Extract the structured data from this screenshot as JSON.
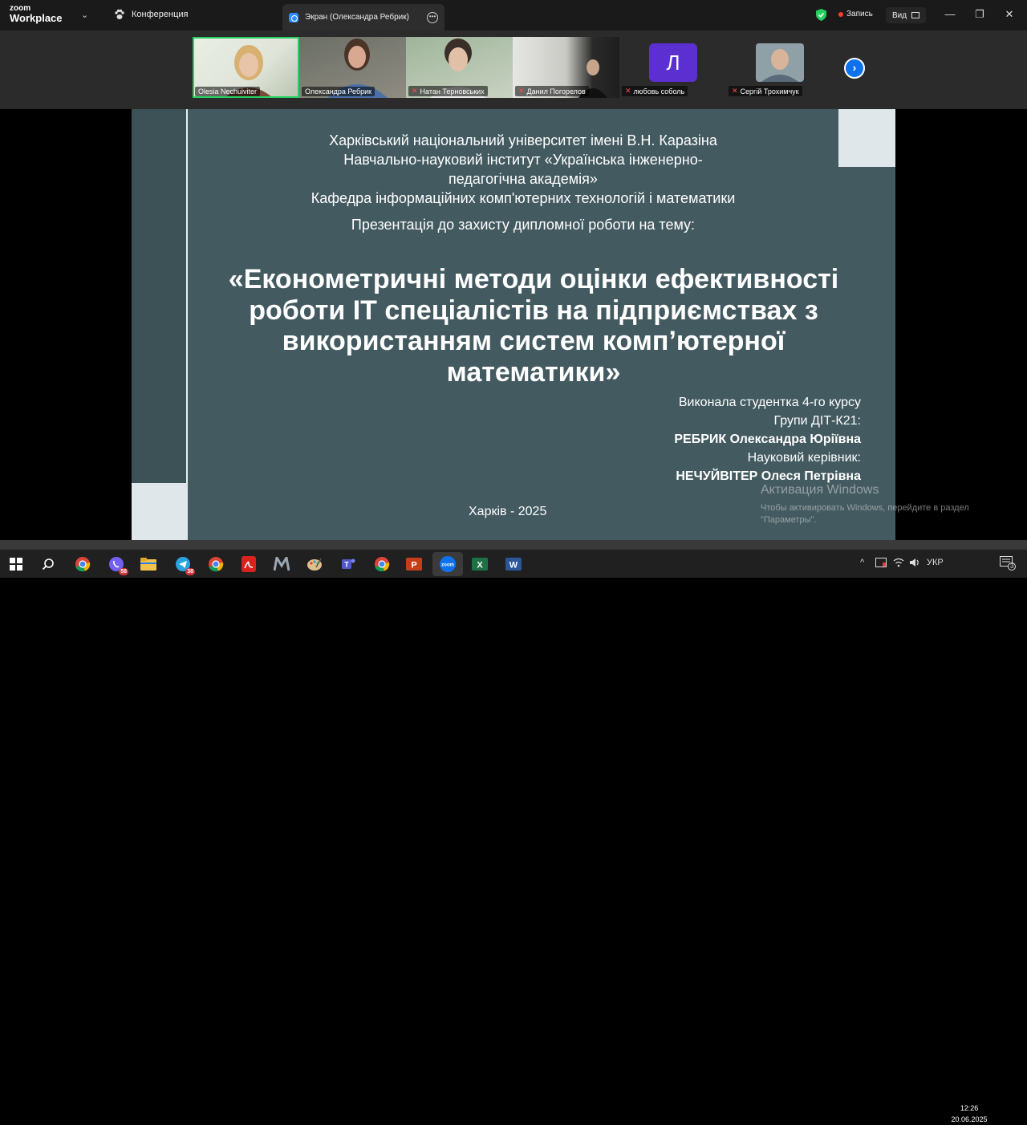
{
  "app": {
    "logo_line1": "zoom",
    "logo_line2": "Workplace"
  },
  "topbar": {
    "conference_label": "Конференция",
    "screen_tab_label": "Экран (Олександра Ребрик)",
    "record_label": "Запись",
    "view_label": "Вид",
    "minimize": "—",
    "maximize": "❐",
    "close": "✕"
  },
  "participants": [
    {
      "name": "Olesia Nechuiviter",
      "muted": false,
      "active": true
    },
    {
      "name": "Олександра Ребрик",
      "muted": false,
      "active": false
    },
    {
      "name": "Натан Терновських",
      "muted": true,
      "active": false
    },
    {
      "name": "Данил Погорелов",
      "muted": true,
      "active": false
    },
    {
      "name": "любовь соболь",
      "muted": true,
      "active": false,
      "avatar_letter": "Л"
    },
    {
      "name": "Сергій Трохимчук",
      "muted": true,
      "active": false
    }
  ],
  "next_icon": "›",
  "mute_icon": "✕",
  "slide": {
    "header_lines": [
      "Харківський національний університет імені В.Н. Каразіна",
      "Навчально-науковий інститут «Українська інженерно-",
      "педагогічна академія»",
      "Кафедра інформаційних комп'ютерних технологій і математики"
    ],
    "subject_line": "Презентація до захисту дипломної роботи на тему:",
    "title_lines": [
      "«Економетричні методи оцінки ефективності",
      "роботи IT спеціалістів на підприємствах з",
      "використанням систем комп’ютерної",
      "математики»"
    ],
    "info": {
      "line1": "Виконала студентка 4-го курсу",
      "line2": "Групи ДІТ-К21:",
      "student": "РЕБРИК Олександра Юріївна",
      "line4": "Науковий керівник:",
      "supervisor": "НЕЧУЙВІТЕР Олеся Петрівна"
    },
    "city_year": "Харків - 2025"
  },
  "watermark": {
    "title": "Активация Windows",
    "line1": "Чтобы активировать Windows, перейдите в раздел",
    "line2": "\"Параметры\"."
  },
  "taskbar": {
    "viber_badge": "58",
    "telegram_badge": "38",
    "lang": "УКР",
    "time": "12:26",
    "date": "20.06.2025",
    "notif_count": "3",
    "chevron": "^"
  }
}
